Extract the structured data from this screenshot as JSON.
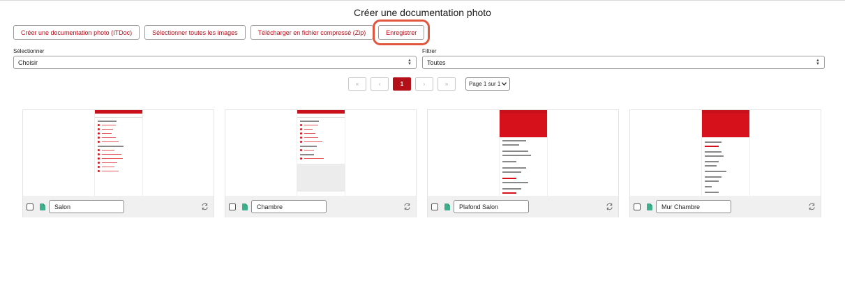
{
  "page": {
    "title": "Créer une documentation photo"
  },
  "toolbar": {
    "create_label": "Créer une documentation photo (ITDoc)",
    "select_all_label": "Sélectionner toutes les images",
    "download_zip_label": "Télécharger en fichier compressé (Zip)",
    "save_label": "Enregistrer"
  },
  "selection": {
    "label": "Sélectionner",
    "value": "Choisir"
  },
  "filter": {
    "label": "Filtrer",
    "value": "Toutes"
  },
  "pagination": {
    "first": "«",
    "prev": "‹",
    "current": "1",
    "next": "›",
    "last": "»",
    "page_select": "Page 1 sur 1"
  },
  "cards": [
    {
      "name": "Salon",
      "icon": "file-icon"
    },
    {
      "name": "Chambre",
      "icon": "file-icon"
    },
    {
      "name": "Plafond Salon",
      "icon": "file-icon"
    },
    {
      "name": "Mur Chambre",
      "icon": "file-icon"
    }
  ],
  "colors": {
    "accent": "#b3101a",
    "highlight_ring": "#e0563f",
    "file_icon": "#3fae8c"
  }
}
